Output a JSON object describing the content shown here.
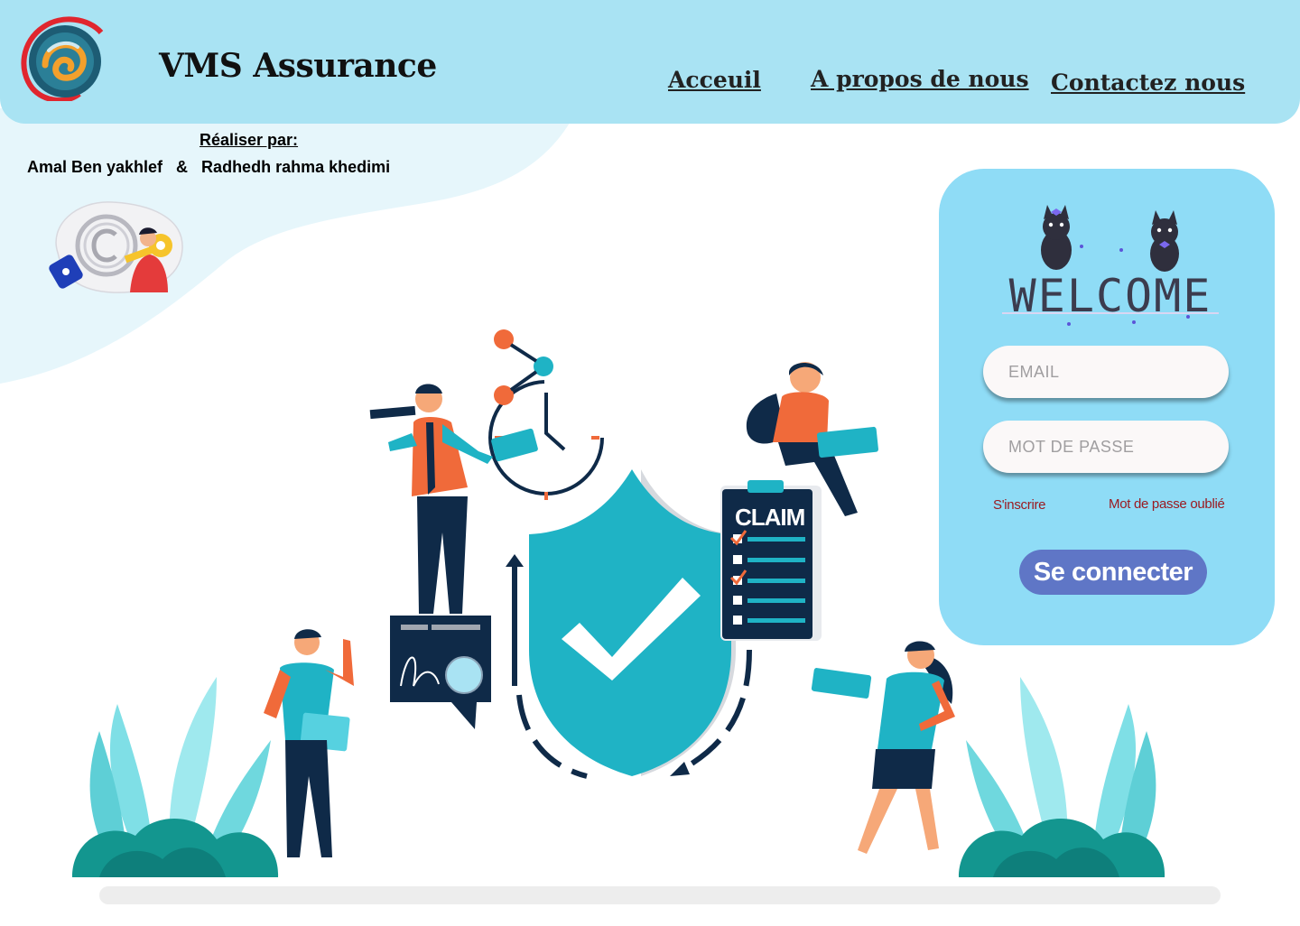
{
  "header": {
    "brand": "VMS Assurance",
    "nav": [
      {
        "label": "Acceuil"
      },
      {
        "label": "A propos de nous"
      },
      {
        "label": "Contactez nous"
      }
    ]
  },
  "credits": {
    "label": "Réaliser par:",
    "names": "Amal Ben yakhlef   &   Radhedh rahma khedimi"
  },
  "hero": {
    "claim_label": "CLAIM"
  },
  "login": {
    "welcome": "WELCOME",
    "email_placeholder": "EMAIL",
    "password_placeholder": "MOT DE PASSE",
    "signup_label": "S'inscrire",
    "forgot_label": "Mot de passe oublié",
    "submit_label": "Se connecter"
  },
  "colors": {
    "header_bg": "#a9e3f3",
    "card_bg": "#8fdcf6",
    "button_bg": "#5f76c6",
    "link_color": "#9b1a20",
    "shield": "#1fb3c5",
    "navy": "#0f2a48",
    "orange": "#f06a3a"
  },
  "icons": [
    "logo-swirl-icon",
    "copyright-icon",
    "shield-check-icon",
    "clock-icon",
    "claim-clipboard-icon"
  ]
}
